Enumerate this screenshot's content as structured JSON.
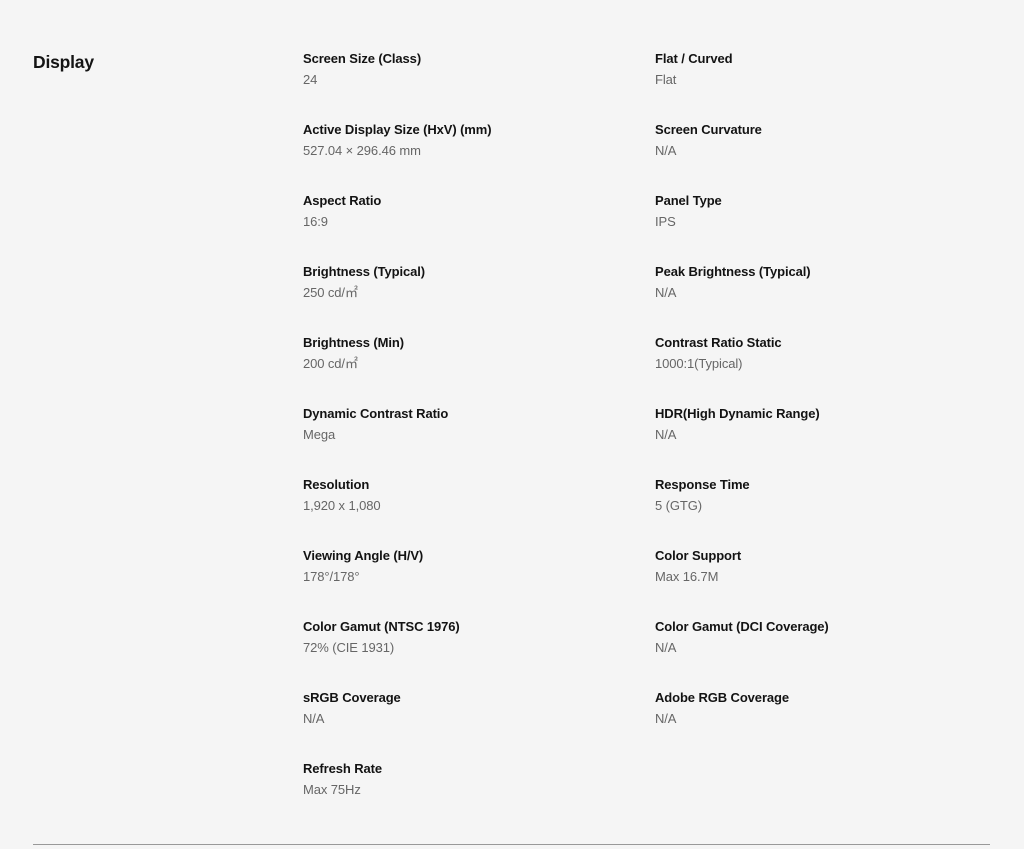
{
  "section": {
    "title": "Display",
    "colors": {
      "background": "#f5f5f5",
      "label_text": "#131313",
      "value_text": "#666666",
      "divider": "#999999"
    }
  },
  "columns": [
    {
      "name": "column-left",
      "items": [
        {
          "label": "Screen Size (Class)",
          "value": "24"
        },
        {
          "label": "Active Display Size (HxV) (mm)",
          "value": "527.04 × 296.46 mm"
        },
        {
          "label": "Aspect Ratio",
          "value": "16:9"
        },
        {
          "label": "Brightness (Typical)",
          "value": "250 cd/㎡"
        },
        {
          "label": "Brightness (Min)",
          "value": "200 cd/㎡"
        },
        {
          "label": "Dynamic Contrast Ratio",
          "value": "Mega"
        },
        {
          "label": "Resolution",
          "value": "1,920 x 1,080"
        },
        {
          "label": "Viewing Angle (H/V)",
          "value": "178°/178°"
        },
        {
          "label": "Color Gamut (NTSC 1976)",
          "value": "72% (CIE 1931)"
        },
        {
          "label": "sRGB Coverage",
          "value": "N/A"
        },
        {
          "label": "Refresh Rate",
          "value": "Max 75Hz"
        }
      ]
    },
    {
      "name": "column-right",
      "items": [
        {
          "label": "Flat / Curved",
          "value": "Flat"
        },
        {
          "label": "Screen Curvature",
          "value": "N/A"
        },
        {
          "label": "Panel Type",
          "value": "IPS"
        },
        {
          "label": "Peak Brightness (Typical)",
          "value": "N/A"
        },
        {
          "label": "Contrast Ratio Static",
          "value": "1000:1(Typical)"
        },
        {
          "label": "HDR(High Dynamic Range)",
          "value": "N/A"
        },
        {
          "label": "Response Time",
          "value": "5 (GTG)"
        },
        {
          "label": "Color Support",
          "value": "Max 16.7M"
        },
        {
          "label": "Color Gamut (DCI Coverage)",
          "value": "N/A"
        },
        {
          "label": "Adobe RGB Coverage",
          "value": "N/A"
        }
      ]
    }
  ]
}
